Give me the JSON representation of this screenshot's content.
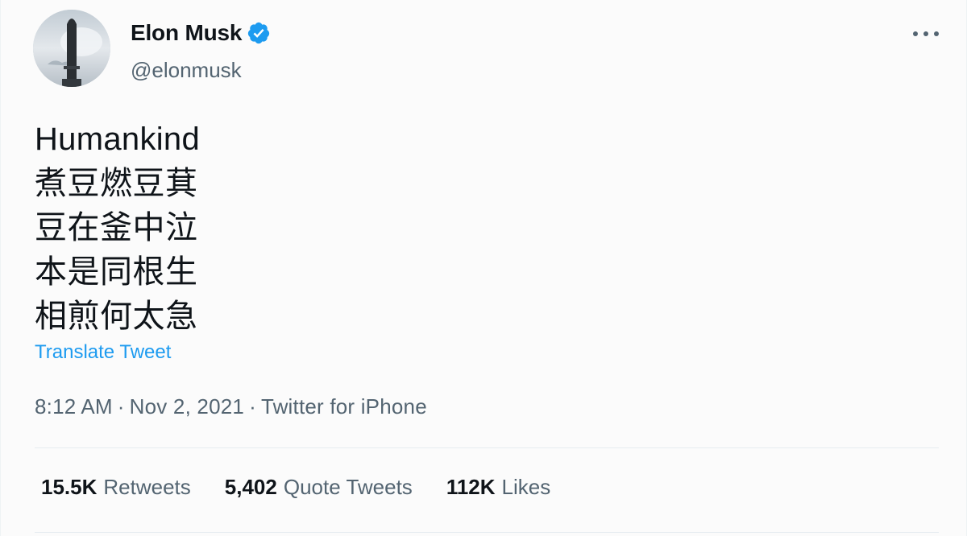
{
  "author": {
    "display_name": "Elon Musk",
    "handle": "@elonmusk",
    "verified_color": "#1d9bf0"
  },
  "tweet": {
    "lines": [
      "Humankind",
      "煮豆燃豆萁",
      "豆在釜中泣",
      "本是同根生",
      "相煎何太急"
    ],
    "translate_label": "Translate Tweet",
    "time": "8:12 AM",
    "date": "Nov 2, 2021",
    "source": "Twitter for iPhone",
    "separator": "·"
  },
  "stats": {
    "retweets_count": "15.5K",
    "retweets_label": "Retweets",
    "quotes_count": "5,402",
    "quotes_label": "Quote Tweets",
    "likes_count": "112K",
    "likes_label": "Likes"
  },
  "icons": {
    "avatar": "avatar-starship-image",
    "verified": "verified-badge-icon",
    "more": "more-options-icon"
  }
}
